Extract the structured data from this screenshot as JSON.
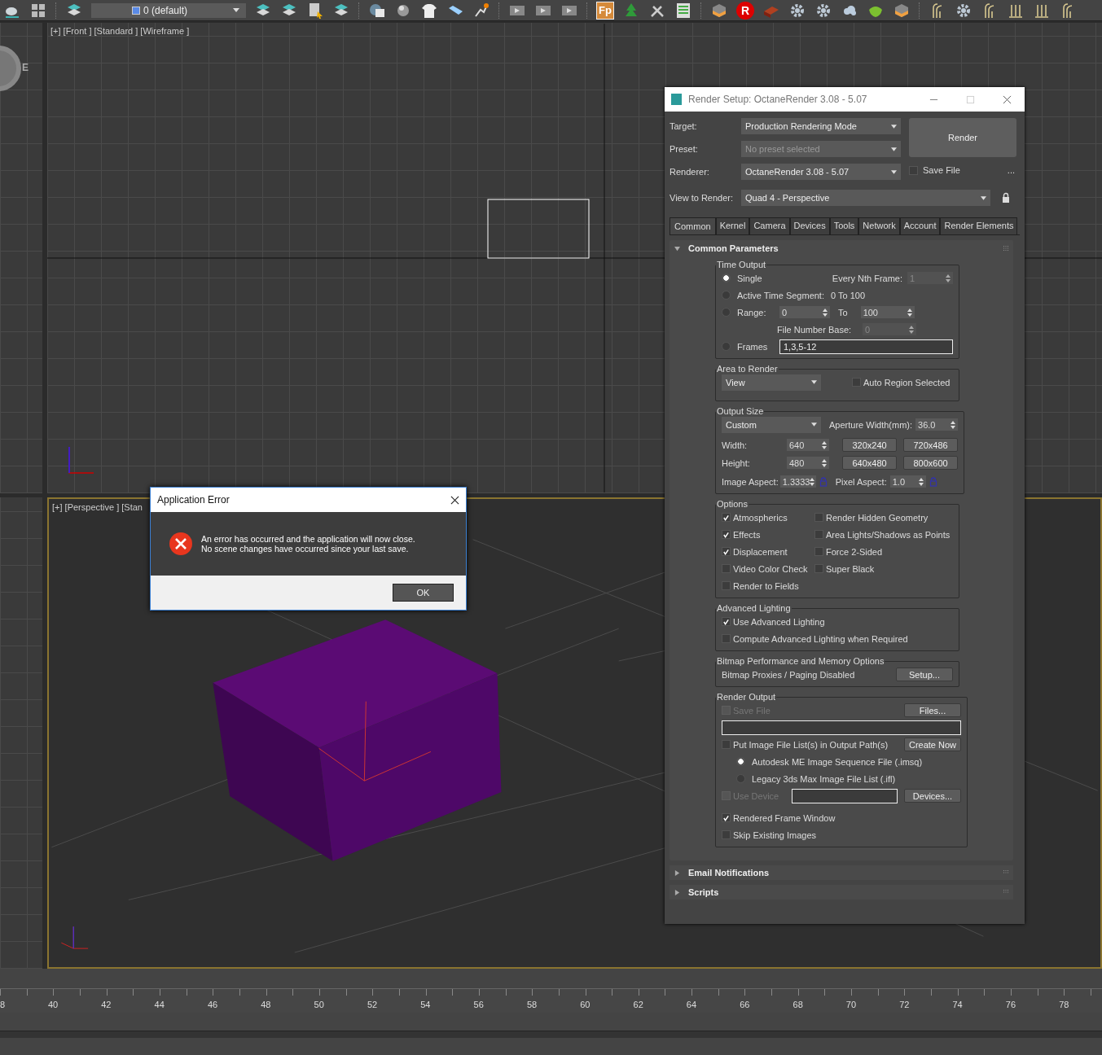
{
  "toolbar": {
    "layer_dropdown": "0 (default)",
    "fp_label": "Fp",
    "r_label": "R"
  },
  "viewports": {
    "viewcube_letter": "E",
    "front_label": "[+] [Front ] [Standard ] [Wireframe ]",
    "perspective_label": "[+] [Perspective ] [Stan"
  },
  "render_setup": {
    "title": "Render Setup: OctaneRender 3.08 - 5.07",
    "target": {
      "label": "Target:",
      "value": "Production Rendering Mode"
    },
    "preset": {
      "label": "Preset:",
      "placeholder": "No preset selected"
    },
    "renderer": {
      "label": "Renderer:",
      "value": "OctaneRender 3.08 - 5.07"
    },
    "save_file": {
      "label": "Save File",
      "checked": false
    },
    "more": "...",
    "view_to_render": {
      "label": "View to Render:",
      "value": "Quad 4 - Perspective"
    },
    "render_button": "Render",
    "tabs": [
      {
        "label": "Common",
        "selected": true
      },
      {
        "label": "Kernel",
        "selected": false
      },
      {
        "label": "Camera",
        "selected": false
      },
      {
        "label": "Devices",
        "selected": false
      },
      {
        "label": "Tools",
        "selected": false
      },
      {
        "label": "Network",
        "selected": false
      },
      {
        "label": "Account",
        "selected": false
      },
      {
        "label": "Render Elements",
        "selected": false
      }
    ],
    "rollout": {
      "title": "Common Parameters",
      "expanded": true
    },
    "time_output": {
      "title": "Time Output",
      "single": {
        "label": "Single",
        "selected": true
      },
      "every_nth": {
        "label": "Every Nth Frame:",
        "value": "1",
        "disabled": true
      },
      "active_segment": {
        "label": "Active Time Segment:",
        "selected": false,
        "value": "0 To 100"
      },
      "range": {
        "label": "Range:",
        "selected": false,
        "from": "0",
        "to_label": "To",
        "to": "100"
      },
      "file_number_base": {
        "label": "File Number Base:",
        "value": "0",
        "disabled": true
      },
      "frames": {
        "label": "Frames",
        "selected": false,
        "value": "1,3,5-12"
      }
    },
    "area_to_render": {
      "title": "Area to Render",
      "dropdown": "View",
      "auto_region": {
        "label": "Auto Region Selected",
        "checked": false
      }
    },
    "output_size": {
      "title": "Output Size",
      "dropdown": "Custom",
      "aperture": {
        "label": "Aperture Width(mm):",
        "value": "36.0"
      },
      "width": {
        "label": "Width:",
        "value": "640"
      },
      "height": {
        "label": "Height:",
        "value": "480"
      },
      "presets": [
        "320x240",
        "720x486",
        "640x480",
        "800x600"
      ],
      "image_aspect": {
        "label": "Image Aspect:",
        "value": "1.3333"
      },
      "pixel_aspect": {
        "label": "Pixel Aspect:",
        "value": "1.0"
      }
    },
    "options": {
      "title": "Options",
      "columns": [
        [
          {
            "label": "Atmospherics",
            "checked": true
          },
          {
            "label": "Effects",
            "checked": true
          },
          {
            "label": "Displacement",
            "checked": true
          },
          {
            "label": "Video Color Check",
            "checked": false
          },
          {
            "label": "Render to Fields",
            "checked": false
          }
        ],
        [
          {
            "label": "Render Hidden Geometry",
            "checked": false
          },
          {
            "label": "Area Lights/Shadows as Points",
            "checked": false
          },
          {
            "label": "Force 2-Sided",
            "checked": false
          },
          {
            "label": "Super Black",
            "checked": false
          }
        ]
      ]
    },
    "advanced_lighting": {
      "title": "Advanced Lighting",
      "items": [
        {
          "label": "Use Advanced Lighting",
          "checked": true
        },
        {
          "label": "Compute Advanced Lighting when Required",
          "checked": false
        }
      ]
    },
    "bitmap": {
      "title": "Bitmap Performance and Memory Options",
      "status": "Bitmap Proxies / Paging Disabled",
      "button": "Setup..."
    },
    "render_output": {
      "title": "Render Output",
      "save_file": {
        "label": "Save File",
        "checked": false,
        "disabled": true
      },
      "files_button": "Files...",
      "put_list": {
        "label": "Put Image File List(s) in Output Path(s)",
        "checked": false
      },
      "create_button": "Create Now",
      "list_types": [
        {
          "label": "Autodesk ME Image Sequence File (.imsq)",
          "selected": true
        },
        {
          "label": "Legacy 3ds Max Image File List (.ifl)",
          "selected": false
        }
      ],
      "use_device": {
        "label": "Use Device",
        "checked": false,
        "disabled": true
      },
      "devices_button": "Devices...",
      "items": [
        {
          "label": "Rendered Frame Window",
          "checked": true
        },
        {
          "label": "Skip Existing Images",
          "checked": false
        }
      ]
    },
    "collapsed_rollouts": [
      {
        "title": "Email Notifications",
        "expanded": false
      },
      {
        "title": "Scripts",
        "expanded": false
      }
    ]
  },
  "error_dialog": {
    "title": "Application Error",
    "lines": [
      "An error has occurred and the application will now close.",
      "No scene changes have occurred since your last save."
    ],
    "button": "OK"
  },
  "timeline": {
    "labels": [
      "8",
      "40",
      "42",
      "44",
      "46",
      "48",
      "50",
      "52",
      "54",
      "56",
      "58",
      "60",
      "62",
      "64",
      "66",
      "68",
      "70",
      "72",
      "74",
      "76",
      "78"
    ]
  }
}
